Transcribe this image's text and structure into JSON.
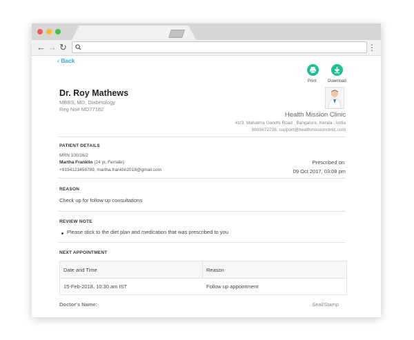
{
  "back_label": "Back",
  "actions": {
    "print_label": "Print",
    "download_label": "Download",
    "accent": "#1fbf94"
  },
  "doctor": {
    "name": "Dr. Roy Mathews",
    "qualifications": "MBBS, MD, Diabetology",
    "reg": "Reg No# MD77182"
  },
  "clinic": {
    "name": "Health Mission Clinic",
    "address": "41/3, Mahatma Gandhi Road , Bangalore, Kerala , India",
    "contact": "9895672738, support@healthmissionclinic.com"
  },
  "patient": {
    "heading": "PATIENT DETAILS",
    "mrn": "MRN:100/16/2",
    "name": "Martha Franklin",
    "age_gender": "(24 yr, Female)",
    "contact": "+9194123456789, martha.franklin2018@gmail.com",
    "prescribed_label": "Prescribed on:",
    "prescribed_date": "09 Oct 2017, 03:08 pm"
  },
  "reason": {
    "heading": "REASON",
    "text": "Check up for follow up consultations"
  },
  "review": {
    "heading": "REVIEW NOTE",
    "items": [
      "Please stick to the diet plan and medication that was prescribed to you"
    ]
  },
  "appointment": {
    "heading": "NEXT APPOINTMENT",
    "columns": [
      "Date and Time",
      "Reason"
    ],
    "rows": [
      [
        "15-Feb-2018, 10:30 am IST",
        "Follow up appointment"
      ]
    ]
  },
  "footer": {
    "doctor_label": "Doctor's Name:",
    "seal_label": "Seal/Stamp"
  }
}
